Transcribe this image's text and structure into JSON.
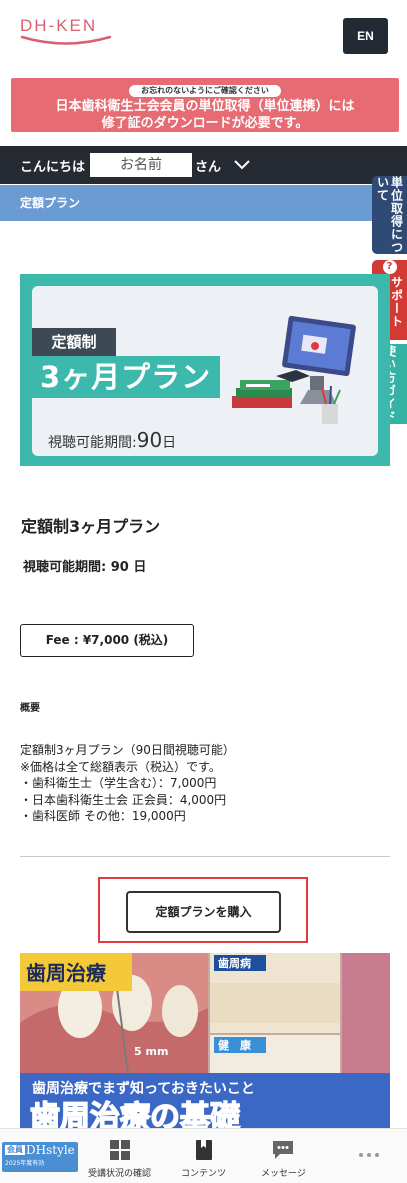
{
  "header": {
    "logo_text": "DH-KEN",
    "lang_button": "EN"
  },
  "notice": {
    "pill": "お忘れのないようにご確認ください",
    "line1": "日本歯科衛生士会会員の単位取得（単位連携）には",
    "line2": "修了証のダウンロードが必要です。"
  },
  "greeting": {
    "hello": "こんにちは",
    "name_value": "お名前",
    "suffix": "さん"
  },
  "section": {
    "title": "定額プラン"
  },
  "side_tabs": {
    "credit": "単位取得について",
    "support": "サポートページ",
    "guide": "使い方ガイド"
  },
  "banner": {
    "tag": "定額制",
    "title": "3ヶ月プラン",
    "period_label": "視聴可能期間:",
    "period_value": "90",
    "period_unit": "日"
  },
  "plan": {
    "title": "定額制3ヶ月プラン",
    "period": "視聴可能期間: 90 日",
    "fee": "Fee : ¥7,000 (税込)"
  },
  "overview": {
    "label": "概要",
    "lines": [
      "定額制3ヶ月プラン（90日間視聴可能）",
      "※価格は全て総額表示（税込）です。",
      "・歯科衛生士（学生含む）：7,000円",
      "・日本歯科衛生士会 正会員：4,000円",
      "・歯科医師 その他：19,000円"
    ]
  },
  "purchase_button": "定額プランを購入",
  "promo": {
    "tag": "歯周治療",
    "label_disease": "歯周病",
    "label_healthy": "健　康",
    "measure": "5 mm",
    "subtitle": "歯周治療でまず知っておきたいこと",
    "title": "歯周治療の基礎"
  },
  "bottom_nav": {
    "badge_top": "会員",
    "badge_name": "DHstyle",
    "badge_note": "2025年度有効",
    "items": [
      {
        "label": "受講状況の確認",
        "icon": "grid-icon"
      },
      {
        "label": "コンテンツ",
        "icon": "book-icon"
      },
      {
        "label": "メッセージ",
        "icon": "chat-icon"
      },
      {
        "label": "",
        "icon": "more-icon"
      }
    ]
  },
  "colors": {
    "notice_bg": "#e66b73",
    "dark_bar": "#262b33",
    "section_bar": "#6b9bd3",
    "teal": "#3cb8ad",
    "highlight": "#e0393e"
  }
}
